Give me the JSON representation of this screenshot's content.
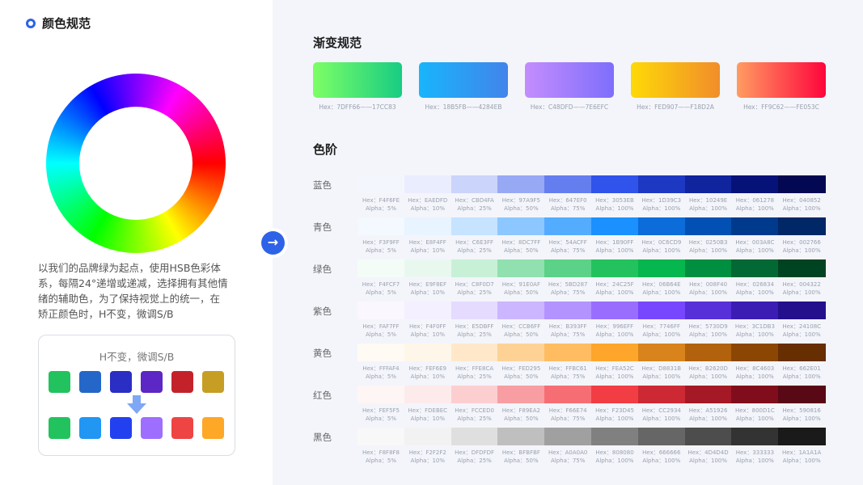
{
  "left": {
    "title": "颜色规范",
    "description": "以我们的品牌绿为起点，使用HSB色彩体系，每隔24°递增或递减，选择拥有其他情绪的辅助色，为了保持视觉上的统一，在矫正颜色时，H不变，微调S/B",
    "description_lines": [
      "以我们的品牌绿为起点，使用HSB色彩体",
      "系，每隔24°递增或递减，选择拥有其他情",
      "绪的辅助色，为了保持视觉上的统一，在",
      "矫正颜色时，H不变，微调S/B"
    ],
    "demo_title": "H不变，微调S/B",
    "before_colors": [
      "#22c35e",
      "#2467c8",
      "#2a2ec4",
      "#5c27c4",
      "#c4222b",
      "#c79e24"
    ],
    "after_colors": [
      "#22c35e",
      "#2196f3",
      "#2340f0",
      "#9e6eff",
      "#ef4444",
      "#ffa726"
    ],
    "arrow_color": "#7ea7f5"
  },
  "arrow_button": {
    "glyph": "→",
    "color": "#2e63e8"
  },
  "gradients": {
    "title": "渐变规范",
    "items": [
      {
        "from": "#7DFF66",
        "to": "#17CC83",
        "caption": "Hex：7DFF66——17CC83"
      },
      {
        "from": "#18B5FB",
        "to": "#4284EB",
        "caption": "Hex：18B5FB——4284EB"
      },
      {
        "from": "#C48DFD",
        "to": "#7E6EFC",
        "caption": "Hex：C48DFD——7E6EFC"
      },
      {
        "from": "#FED907",
        "to": "#F18D2A",
        "caption": "Hex：FED907——F18D2A"
      },
      {
        "from": "#FF9C62",
        "to": "#FE053C",
        "caption": "Hex：FF9C62——FE053C"
      }
    ]
  },
  "scales": {
    "title": "色阶",
    "alphas": [
      "Alpha：5%",
      "Alpha：10%",
      "Alpha：25%",
      "Alpha：50%",
      "Alpha：75%",
      "Alpha：100%",
      "Alpha：100%",
      "Alpha：100%",
      "Alpha：100%",
      "Alpha：100%"
    ],
    "rows": [
      {
        "label": "蓝色",
        "colors": [
          "F4F6FE",
          "EAEDFD",
          "CBD4FA",
          "97A9F5",
          "647EF0",
          "3053EB",
          "1D39C3",
          "10249E",
          "061278",
          "040852"
        ]
      },
      {
        "label": "青色",
        "colors": [
          "F3F9FF",
          "E8F4FF",
          "C6E3FF",
          "8DC7FF",
          "54ACFF",
          "1B90FF",
          "0C6CD9",
          "0250B3",
          "003A8C",
          "002766"
        ]
      },
      {
        "label": "绿色",
        "colors": [
          "F4FCF7",
          "E9F8EF",
          "C8F0D7",
          "91E0AF",
          "5BD287",
          "24C25F",
          "06B64E",
          "008F40",
          "026834",
          "004322"
        ]
      },
      {
        "label": "紫色",
        "colors": [
          "FAF7FF",
          "F4F0FF",
          "E5DBFF",
          "CCB6FF",
          "B393FF",
          "996EFF",
          "7746FF",
          "5730D9",
          "3C1DB3",
          "24108C"
        ]
      },
      {
        "label": "黄色",
        "colors": [
          "FFFAF4",
          "FEF6E9",
          "FFE8CA",
          "FED295",
          "FFBC61",
          "FEA52C",
          "D8831B",
          "B2620D",
          "8C4603",
          "662E01"
        ]
      },
      {
        "label": "红色",
        "colors": [
          "FEF5F5",
          "FDEBEC",
          "FCCED0",
          "F89EA2",
          "F66E74",
          "F23D45",
          "CC2934",
          "A51926",
          "800D1C",
          "590816"
        ]
      },
      {
        "label": "黑色",
        "colors": [
          "F8F8F8",
          "F2F2F2",
          "DFDFDF",
          "BFBFBF",
          "A0A0A0",
          "808080",
          "666666",
          "4D4D4D",
          "333333",
          "1A1A1A"
        ]
      }
    ]
  }
}
